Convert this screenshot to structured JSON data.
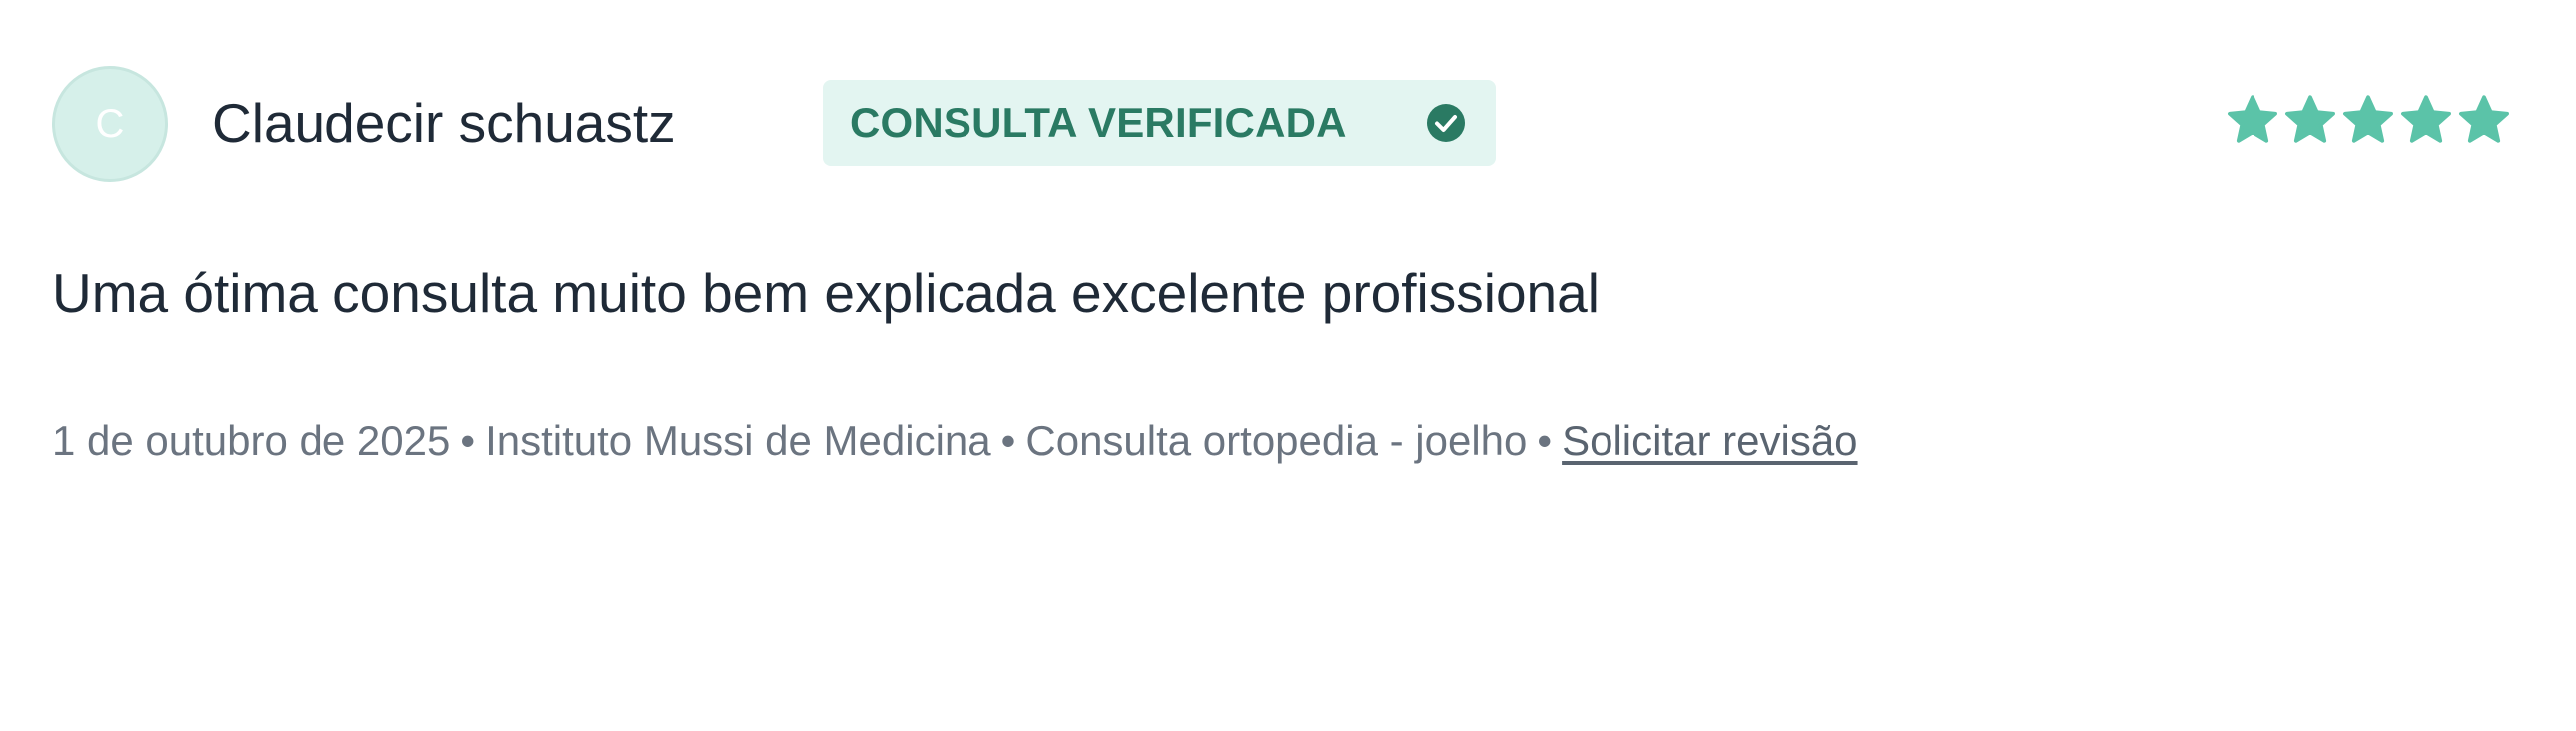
{
  "review": {
    "avatar_initial": "C",
    "author_name": "Claudecir schuastz",
    "badge_label": "CONSULTA VERIFICADA",
    "rating": 5,
    "rating_max": 5,
    "text": "Uma ótima consulta muito bem explicada excelente profissional",
    "meta": {
      "date": "1 de outubro de 2025",
      "clinic": "Instituto Mussi de Medicina",
      "service": "Consulta ortopedia - joelho",
      "separator": "•",
      "review_link": "Solicitar revisão"
    }
  },
  "colors": {
    "accent": "#5bc3a8",
    "badge_bg": "#e3f5f1",
    "badge_text": "#2a7a63",
    "avatar_bg": "#d6f0ea"
  },
  "icons": {
    "check": "check-circle-icon",
    "star": "star-icon"
  }
}
